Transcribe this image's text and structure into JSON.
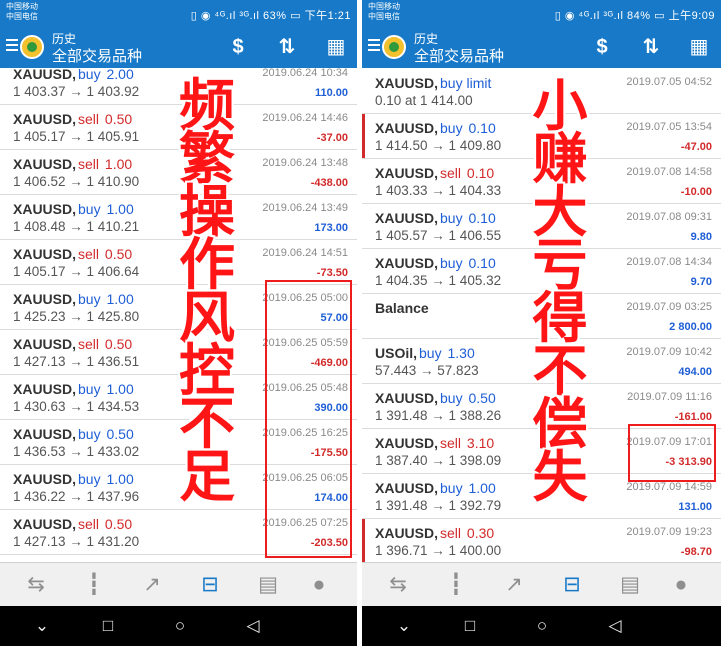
{
  "left": {
    "status": {
      "carrier_line1": "中国移动",
      "carrier_line2": "中国电信",
      "indicators": "▯ ◉ ⁴ᴳ.ıl ³ᴳ.ıl 63% ▭ 下午1:21"
    },
    "header": {
      "section": "历史",
      "title": "全部交易品种"
    },
    "overlay_text": [
      "频",
      "繁",
      "操",
      "作",
      "风",
      "控",
      "不",
      "足"
    ],
    "rows": [
      {
        "symbol": "XAUUSD,",
        "side": "buy",
        "volume": "2.00",
        "prices": "1 403.37 → 1 403.92",
        "time": "2019.06.24 10:34",
        "profit": "110.00"
      },
      {
        "symbol": "XAUUSD,",
        "side": "sell",
        "volume": "0.50",
        "prices": "1 405.17 → 1 405.91",
        "time": "2019.06.24 14:46",
        "profit": "-37.00"
      },
      {
        "symbol": "XAUUSD,",
        "side": "sell",
        "volume": "1.00",
        "prices": "1 406.52 → 1 410.90",
        "time": "2019.06.24 13:48",
        "profit": "-438.00"
      },
      {
        "symbol": "XAUUSD,",
        "side": "buy",
        "volume": "1.00",
        "prices": "1 408.48 → 1 410.21",
        "time": "2019.06.24 13:49",
        "profit": "173.00"
      },
      {
        "symbol": "XAUUSD,",
        "side": "sell",
        "volume": "0.50",
        "prices": "1 405.17 → 1 406.64",
        "time": "2019.06.24 14:51",
        "profit": "-73.50"
      },
      {
        "symbol": "XAUUSD,",
        "side": "buy",
        "volume": "1.00",
        "prices": "1 425.23 → 1 425.80",
        "time": "2019.06.25 05:00",
        "profit": "57.00"
      },
      {
        "symbol": "XAUUSD,",
        "side": "sell",
        "volume": "0.50",
        "prices": "1 427.13 → 1 436.51",
        "time": "2019.06.25 05:59",
        "profit": "-469.00"
      },
      {
        "symbol": "XAUUSD,",
        "side": "buy",
        "volume": "1.00",
        "prices": "1 430.63 → 1 434.53",
        "time": "2019.06.25 05:48",
        "profit": "390.00"
      },
      {
        "symbol": "XAUUSD,",
        "side": "buy",
        "volume": "0.50",
        "prices": "1 436.53 → 1 433.02",
        "time": "2019.06.25 16:25",
        "profit": "-175.50"
      },
      {
        "symbol": "XAUUSD,",
        "side": "buy",
        "volume": "1.00",
        "prices": "1 436.22 → 1 437.96",
        "time": "2019.06.25 06:05",
        "profit": "174.00"
      },
      {
        "symbol": "XAUUSD,",
        "side": "sell",
        "volume": "0.50",
        "prices": "1 427.13 → 1 431.20",
        "time": "2019.06.25 07:25",
        "profit": "-203.50"
      }
    ]
  },
  "right": {
    "status": {
      "carrier_line1": "中国移动",
      "carrier_line2": "中国电信",
      "indicators": "▯ ◉ ⁴ᴳ.ıl ³ᴳ.ıl 84% ▭ 上午9:09"
    },
    "header": {
      "section": "历史",
      "title": "全部交易品种"
    },
    "overlay_text": [
      "小",
      "赚",
      "大",
      "亏",
      "得",
      "不",
      "偿",
      "失"
    ],
    "rows": [
      {
        "symbol": "XAUUSD,",
        "side": "buy limit",
        "volume": "",
        "prices": "0.10 at 1 414.00",
        "time": "2019.07.05 04:52",
        "profit": ""
      },
      {
        "symbol": "XAUUSD,",
        "side": "buy",
        "volume": "0.10",
        "prices": "1 414.50 → 1 409.80",
        "time": "2019.07.05 13:54",
        "profit": "-47.00"
      },
      {
        "symbol": "XAUUSD,",
        "side": "sell",
        "volume": "0.10",
        "prices": "1 403.33 → 1 404.33",
        "time": "2019.07.08 14:58",
        "profit": "-10.00"
      },
      {
        "symbol": "XAUUSD,",
        "side": "buy",
        "volume": "0.10",
        "prices": "1 405.57 → 1 406.55",
        "time": "2019.07.08 09:31",
        "profit": "9.80"
      },
      {
        "symbol": "XAUUSD,",
        "side": "buy",
        "volume": "0.10",
        "prices": "1 404.35 → 1 405.32",
        "time": "2019.07.08 14:34",
        "profit": "9.70"
      },
      {
        "symbol": "Balance",
        "side": "",
        "volume": "",
        "prices": "",
        "time": "2019.07.09 03:25",
        "profit": "2 800.00"
      },
      {
        "symbol": "USOil,",
        "side": "buy",
        "volume": "1.30",
        "prices": "57.443 → 57.823",
        "time": "2019.07.09 10:42",
        "profit": "494.00"
      },
      {
        "symbol": "XAUUSD,",
        "side": "buy",
        "volume": "0.50",
        "prices": "1 391.48 → 1 388.26",
        "time": "2019.07.09 11:16",
        "profit": "-161.00"
      },
      {
        "symbol": "XAUUSD,",
        "side": "sell",
        "volume": "3.10",
        "prices": "1 387.40 → 1 398.09",
        "time": "2019.07.09 17:01",
        "profit": "-3 313.90"
      },
      {
        "symbol": "XAUUSD,",
        "side": "buy",
        "volume": "1.00",
        "prices": "1 391.48 → 1 392.79",
        "time": "2019.07.09 14:59",
        "profit": "131.00"
      },
      {
        "symbol": "XAUUSD,",
        "side": "sell",
        "volume": "0.30",
        "prices": "1 396.71 → 1 400.00",
        "time": "2019.07.09 19:23",
        "profit": "-98.70"
      }
    ]
  },
  "icons": {
    "toolbar": [
      "currency-toggle-icon",
      "sort-icon",
      "calendar-icon"
    ],
    "bottom": [
      "quotes-icon",
      "chart-icon",
      "trade-icon",
      "history-icon",
      "news-icon",
      "messages-icon"
    ],
    "nav": [
      "back-icon",
      "home-icon",
      "recents-icon",
      "notification-icon"
    ]
  },
  "colors": {
    "header_bg": "#1779c7",
    "buy": "#1f5fd6",
    "sell": "#d22a2a",
    "annotation": "#ee1c1c"
  }
}
